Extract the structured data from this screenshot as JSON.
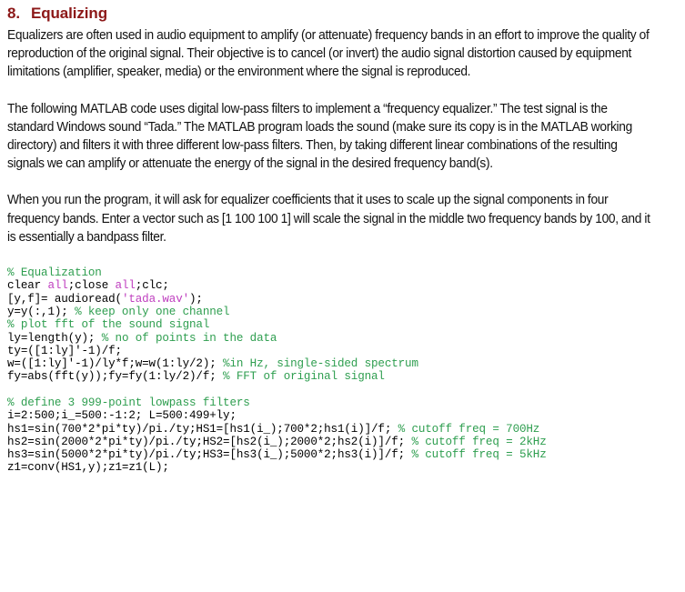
{
  "heading": {
    "number": "8.",
    "title": "Equalizing",
    "color": "#8c1818"
  },
  "paragraphs": [
    "Equalizers are often used in audio equipment to amplify (or attenuate) frequency bands in an effort to improve the quality of reproduction of the original signal. Their objective is to cancel (or invert) the audio signal distortion caused by equipment limitations (amplifier, speaker, media) or the environment where the signal is reproduced.",
    "The following MATLAB code uses digital low-pass filters to implement a “frequency equalizer.” The test signal is the standard Windows sound “Tada.” The MATLAB program loads the sound (make sure its copy is in the MATLAB working directory) and filters it with three different low-pass filters. Then, by taking different linear combinations of the resulting signals we can amplify or attenuate the energy of the signal in the desired frequency band(s).",
    "When you run the program, it will ask for equalizer coefficients that it uses to scale up the signal components in four frequency bands.  Enter a vector such as [1 100 100 1] will scale the signal in the middle two frequency bands by 100, and it is essentially a bandpass filter."
  ],
  "code": {
    "colors": {
      "comment": "#2e9e4f",
      "string": "#bf3fbf",
      "keyword": "#bf3fbf",
      "plain": "#000000"
    },
    "lines": [
      [
        {
          "t": "comment",
          "s": "% Equalization"
        }
      ],
      [
        {
          "t": "plain",
          "s": "clear "
        },
        {
          "t": "kw",
          "s": "all"
        },
        {
          "t": "plain",
          "s": ";close "
        },
        {
          "t": "kw",
          "s": "all"
        },
        {
          "t": "plain",
          "s": ";clc;"
        }
      ],
      [
        {
          "t": "plain",
          "s": "[y,f]= audioread("
        },
        {
          "t": "string",
          "s": "'tada.wav'"
        },
        {
          "t": "plain",
          "s": ");"
        }
      ],
      [
        {
          "t": "plain",
          "s": "y=y(:,1); "
        },
        {
          "t": "comment",
          "s": "% keep only one channel"
        }
      ],
      [
        {
          "t": "comment",
          "s": "% plot fft of the sound signal"
        }
      ],
      [
        {
          "t": "plain",
          "s": "ly=length(y); "
        },
        {
          "t": "comment",
          "s": "% no of points in the data"
        }
      ],
      [
        {
          "t": "plain",
          "s": "ty=([1:ly]'-1)/f;"
        }
      ],
      [
        {
          "t": "plain",
          "s": "w=([1:ly]'-1)/ly*f;w=w(1:ly/2); "
        },
        {
          "t": "comment",
          "s": "%in Hz, single-sided spectrum"
        }
      ],
      [
        {
          "t": "plain",
          "s": "fy=abs(fft(y));fy=fy(1:ly/2)/f; "
        },
        {
          "t": "comment",
          "s": "% FFT of original signal"
        }
      ],
      [],
      [
        {
          "t": "comment",
          "s": "% define 3 999-point lowpass filters"
        }
      ],
      [
        {
          "t": "plain",
          "s": "i=2:500;i_=500:-1:2; L=500:499+ly;"
        }
      ],
      [
        {
          "t": "plain",
          "s": "hs1=sin(700*2*pi*ty)/pi./ty;HS1=[hs1(i_);700*2;hs1(i)]/f; "
        },
        {
          "t": "comment",
          "s": "% cutoff freq = 700Hz"
        }
      ],
      [
        {
          "t": "plain",
          "s": "hs2=sin(2000*2*pi*ty)/pi./ty;HS2=[hs2(i_);2000*2;hs2(i)]/f; "
        },
        {
          "t": "comment",
          "s": "% cutoff freq = 2kHz"
        }
      ],
      [
        {
          "t": "plain",
          "s": "hs3=sin(5000*2*pi*ty)/pi./ty;HS3=[hs3(i_);5000*2;hs3(i)]/f; "
        },
        {
          "t": "comment",
          "s": "% cutoff freq = 5kHz"
        }
      ],
      [
        {
          "t": "plain",
          "s": "z1=conv(HS1,y);z1=z1(L);"
        }
      ]
    ]
  }
}
